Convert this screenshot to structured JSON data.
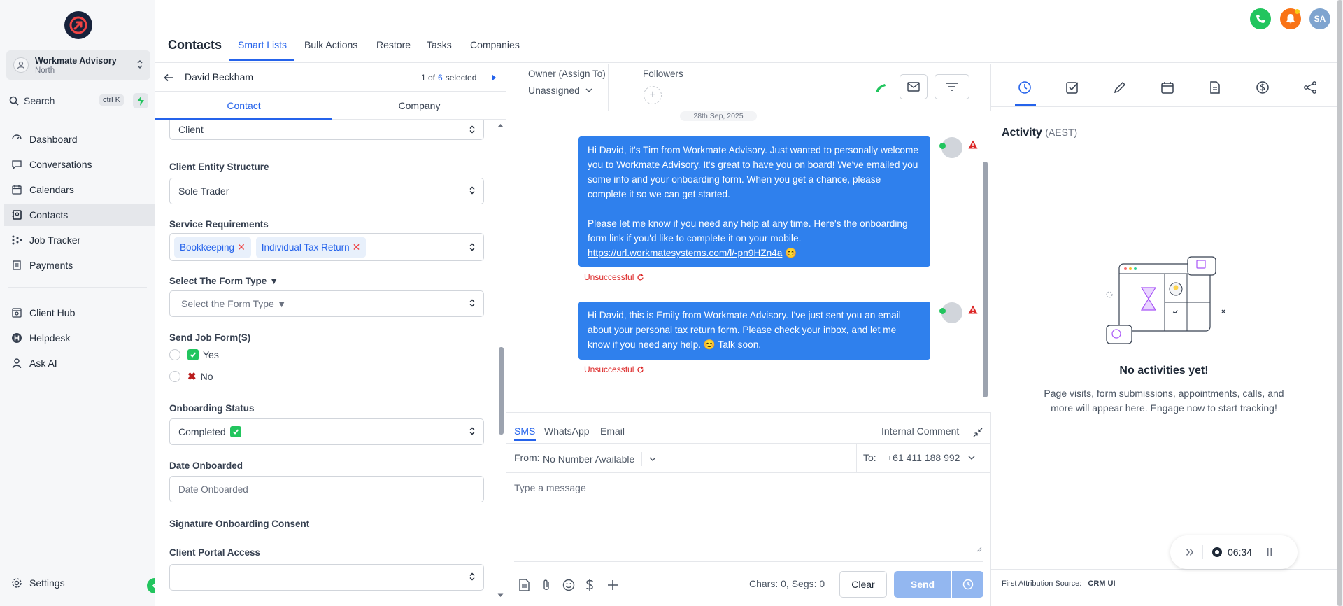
{
  "sidebar": {
    "account_name": "Workmate Advisory",
    "account_sub": "North",
    "search_label": "Search",
    "search_shortcut": "ctrl K",
    "nav": [
      {
        "label": "Dashboard"
      },
      {
        "label": "Conversations"
      },
      {
        "label": "Calendars"
      },
      {
        "label": "Contacts"
      },
      {
        "label": "Job Tracker"
      },
      {
        "label": "Payments"
      },
      {
        "label": "Client Hub"
      },
      {
        "label": "Helpdesk"
      },
      {
        "label": "Ask AI"
      }
    ],
    "settings_label": "Settings"
  },
  "topbar": {
    "title": "Contacts",
    "tabs": [
      {
        "label": "Smart Lists"
      },
      {
        "label": "Bulk Actions"
      },
      {
        "label": "Restore"
      },
      {
        "label": "Tasks"
      },
      {
        "label": "Companies"
      }
    ],
    "user_initials": "SA"
  },
  "contact": {
    "name": "David Beckham",
    "pager_of": "1 of",
    "pager_count": "6",
    "pager_selected": "selected",
    "subtabs": [
      {
        "label": "Contact"
      },
      {
        "label": "Company"
      }
    ],
    "client_type_value": "Client",
    "entity_label": "Client Entity Structure",
    "entity_value": "Sole Trader",
    "service_label": "Service Requirements",
    "service_chips": [
      "Bookkeeping",
      "Individual Tax Return"
    ],
    "form_type_label": "Select The Form Type ▼",
    "form_type_placeholder": "Select the Form Type ▼",
    "send_job_label": "Send Job Form(S)",
    "yes_label": "Yes",
    "no_label": "No",
    "onboarding_label": "Onboarding Status",
    "onboarding_value": "Completed",
    "date_label": "Date Onboarded",
    "date_placeholder": "Date Onboarded",
    "signature_label": "Signature Onboarding Consent",
    "portal_label": "Client Portal Access"
  },
  "conversation": {
    "owner_label": "Owner (Assign To)",
    "owner_value": "Unassigned",
    "followers_label": "Followers",
    "date_divider": "28th Sep, 2025",
    "msg1_p1": "Hi David, it's Tim from Workmate Advisory. Just wanted to personally welcome you to Workmate Advisory. It's great to have you on board! We've emailed you some info and your onboarding form. When you get a chance, please complete it so we can get started.",
    "msg1_p2": "Please let me know if you need any help at any time. Here's the onboarding form link if you'd like to complete it on your mobile.",
    "msg1_link": "https://url.workmatesystems.com/l/-pn9HZn4a",
    "msg1_emoji": "😊",
    "msg1_status": "Unsuccessful",
    "msg2": "Hi David, this is Emily from Workmate Advisory. I've just sent you an email about your personal tax return form. Please check your inbox, and let me know if you need any help. 😊 Talk soon.",
    "msg2_status": "Unsuccessful",
    "channels": [
      {
        "label": "SMS"
      },
      {
        "label": "WhatsApp"
      },
      {
        "label": "Email"
      }
    ],
    "internal_comment": "Internal Comment",
    "from_label": "From:",
    "from_value": "No Number Available",
    "to_label": "To:",
    "to_value": "+61 411 188 992",
    "message_placeholder": "Type a message",
    "chars_info": "Chars: 0, Segs: 0",
    "clear_label": "Clear",
    "send_label": "Send"
  },
  "activity": {
    "title": "Activity",
    "timezone": "(AEST)",
    "empty_title": "No activities yet!",
    "empty_desc": "Page visits, form submissions, appointments, calls, and more will appear here. Engage now to start tracking!",
    "timer": "06:34",
    "attr_label": "First Attribution Source:",
    "attr_value": "CRM UI"
  },
  "colors": {
    "accent": "#2563eb",
    "bubble": "#2f80ed",
    "error": "#dc2626",
    "success": "#22c55e"
  }
}
